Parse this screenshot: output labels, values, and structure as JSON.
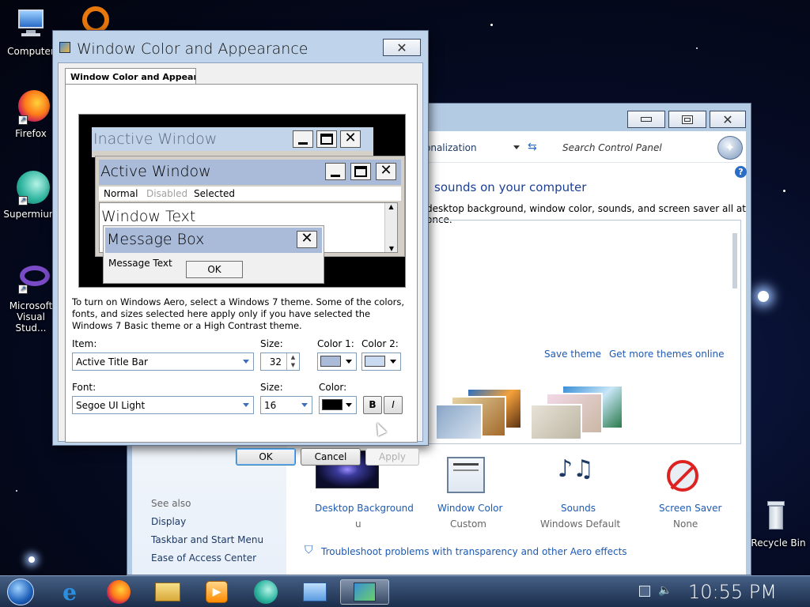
{
  "desktop": {
    "icons": [
      {
        "label": "Computer"
      },
      {
        "label": "Firefox"
      },
      {
        "label": "Supermium"
      },
      {
        "label": "Microsoft Visual Stud..."
      },
      {
        "label": "Recycle Bin"
      }
    ]
  },
  "control_panel": {
    "breadcrumb": "onalization",
    "search_placeholder": "Search Control Panel",
    "heading": "sounds on your computer",
    "description": "desktop background, window color, sounds, and screen saver all at once.",
    "save_theme": "Save theme",
    "get_more_themes": "Get more themes online",
    "see_also": "See also",
    "see_also_links": [
      "Display",
      "Taskbar and Start Menu",
      "Ease of Access Center"
    ],
    "bottom_items": [
      {
        "title": "Desktop Background",
        "sub": "u"
      },
      {
        "title": "Window Color",
        "sub": "Custom"
      },
      {
        "title": "Sounds",
        "sub": "Windows Default"
      },
      {
        "title": "Screen Saver",
        "sub": "None"
      }
    ],
    "troubleshoot": "Troubleshoot problems with transparency and other Aero effects"
  },
  "dialog": {
    "title": "Window Color and Appearance",
    "tab": "Window Color and Appearance",
    "preview": {
      "inactive": "Inactive Window",
      "active": "Active Window",
      "menu": [
        "Normal",
        "Disabled",
        "Selected"
      ],
      "window_text": "Window Text",
      "msgbox_title": "Message Box",
      "msgbox_text": "Message Text",
      "ok": "OK"
    },
    "info": "To turn on Windows Aero, select a Windows 7 theme.  Some of the colors, fonts, and sizes selected here apply only if you have selected the Windows 7 Basic theme or a High Contrast theme.",
    "item_label": "Item:",
    "item_value": "Active Title Bar",
    "size_label": "Size:",
    "size_value": "32",
    "color1_label": "Color 1:",
    "color2_label": "Color 2:",
    "font_label": "Font:",
    "font_value": "Segoe UI Light",
    "font_size_label": "Size:",
    "font_size_value": "16",
    "color_label": "Color:",
    "bold": "B",
    "italic": "I",
    "ok": "OK",
    "cancel": "Cancel",
    "apply": "Apply",
    "colors": {
      "color1": "#a9bbd8",
      "color2": "#c9daf0",
      "font_color": "#000000"
    }
  },
  "taskbar": {
    "clock": "10:55 PM",
    "apps": [
      "start-orb-icon",
      "ie-icon",
      "firefox-icon",
      "explorer-icon",
      "media-player-icon",
      "supermium-icon",
      "control-panel-icon",
      "personalize-icon"
    ]
  }
}
